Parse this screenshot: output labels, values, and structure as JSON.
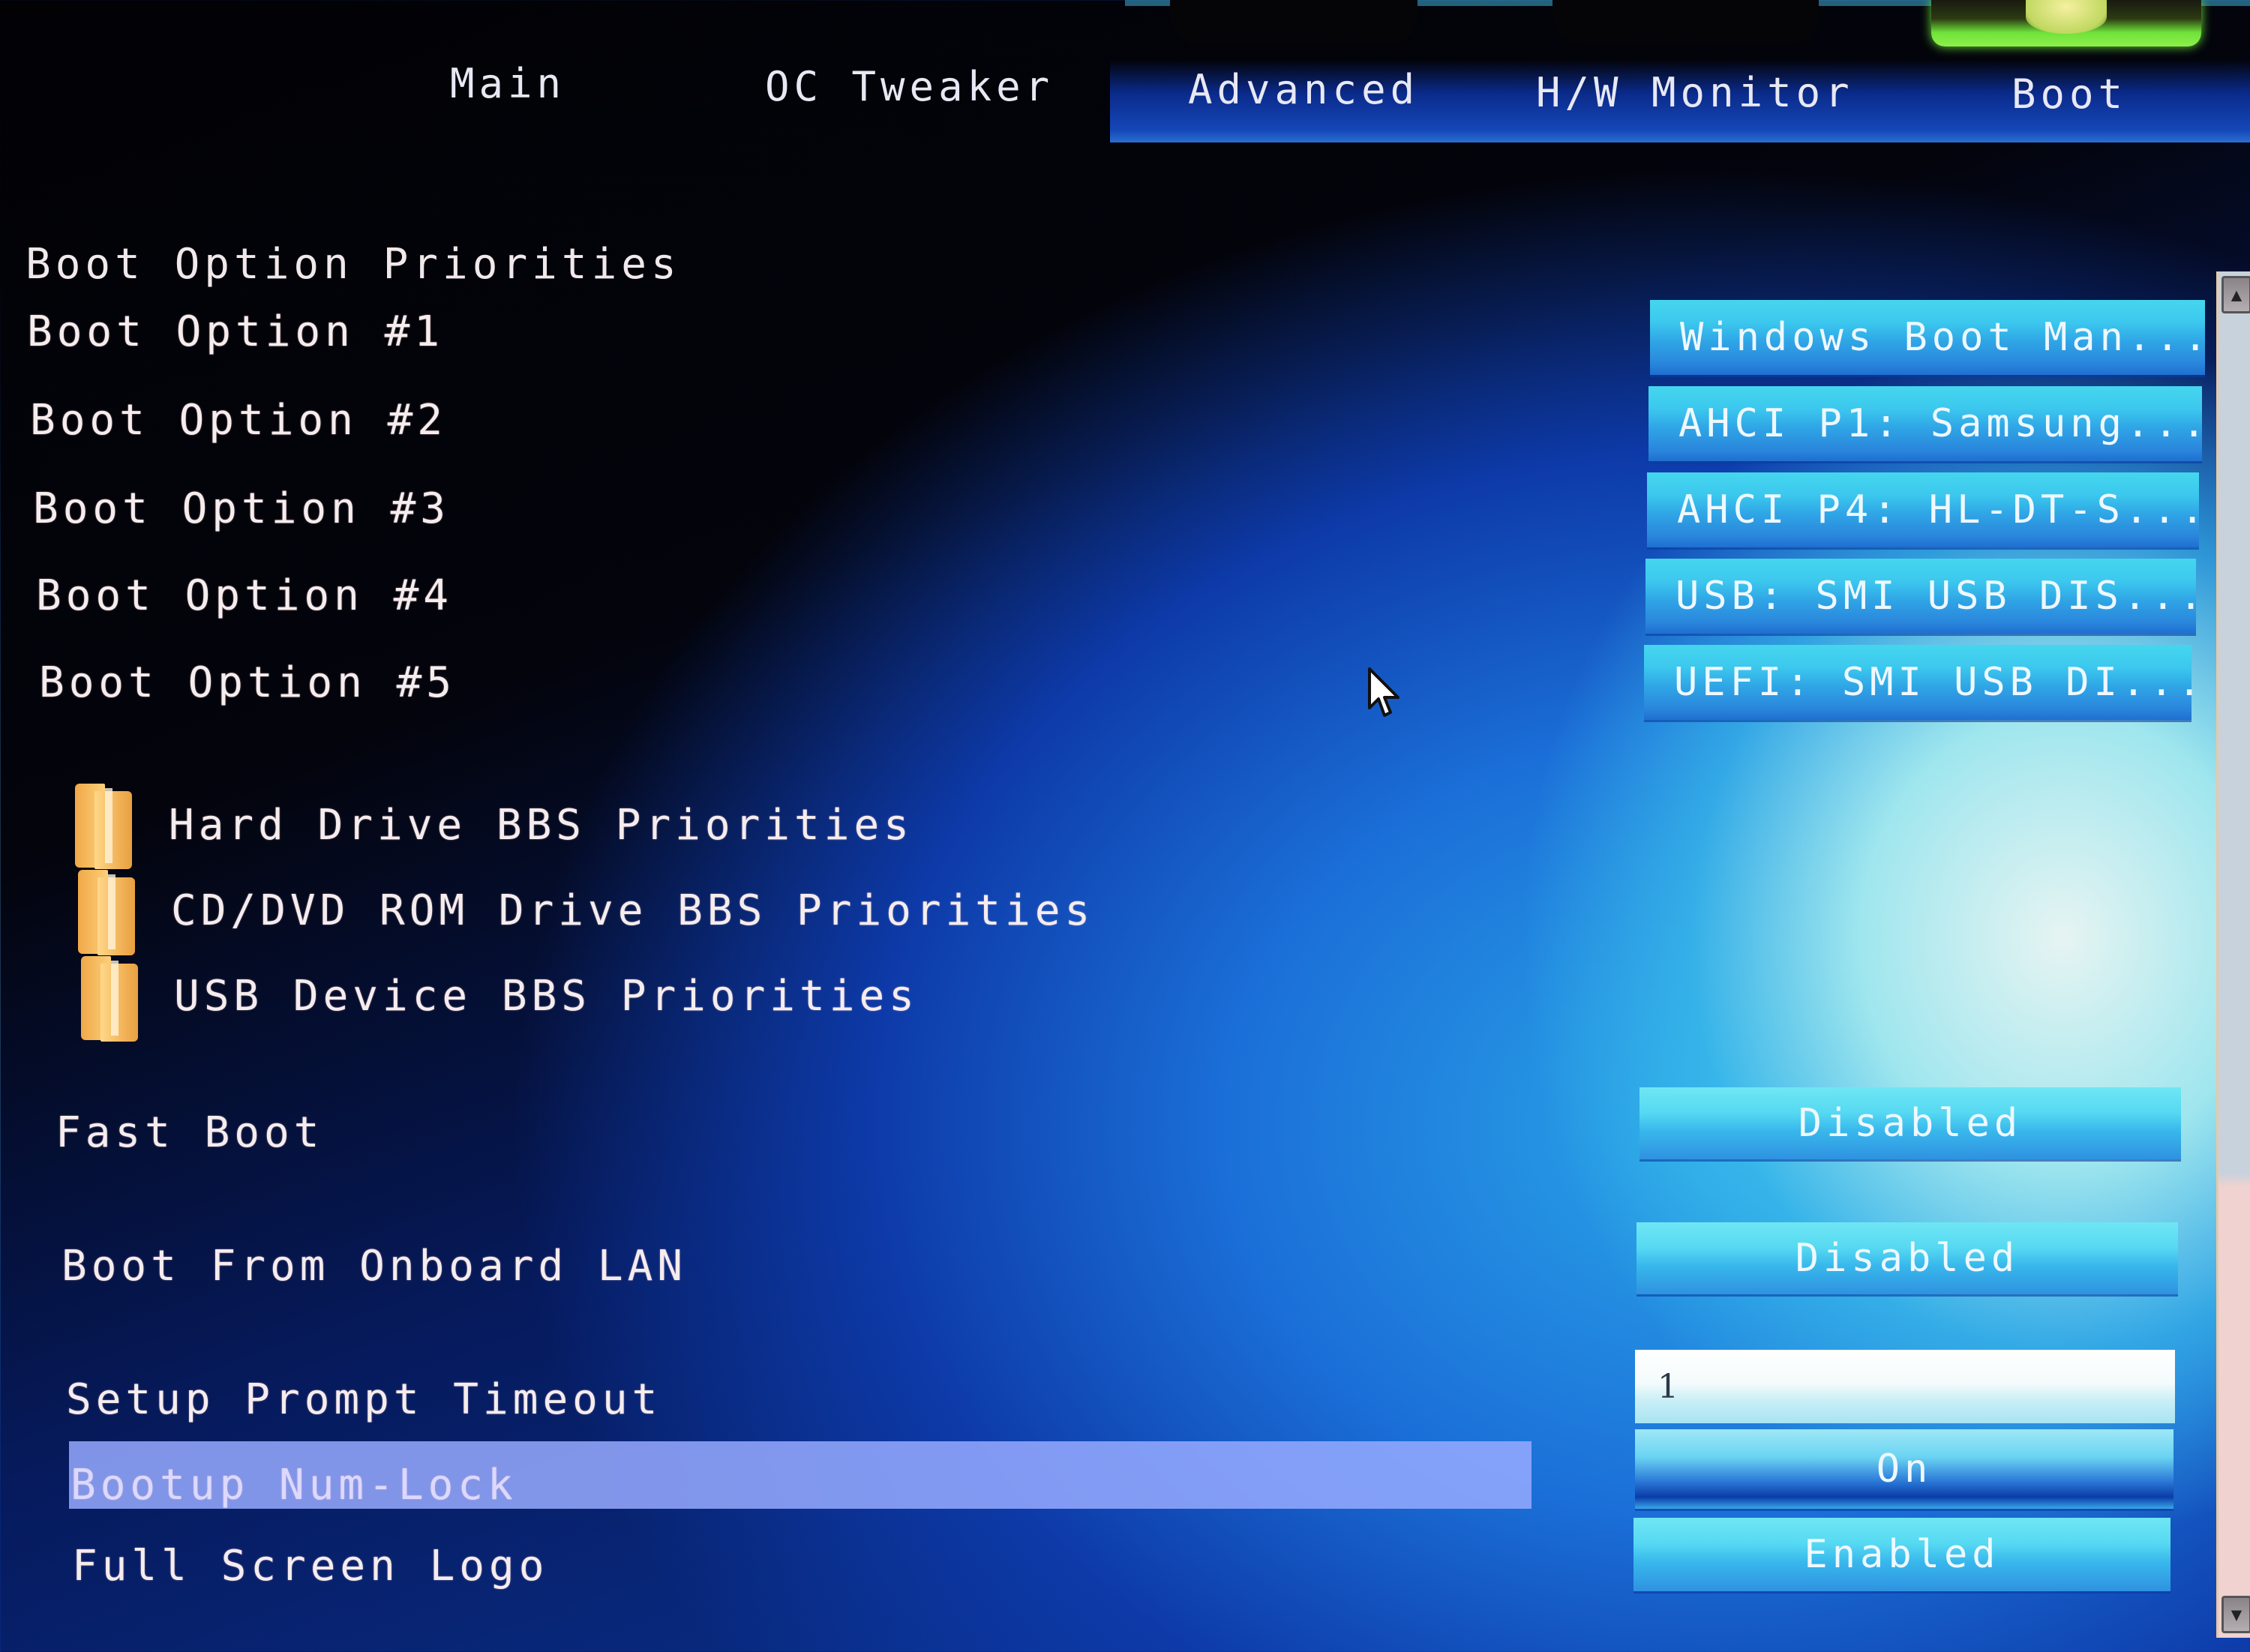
{
  "tabs": [
    {
      "label": "Main",
      "active": false
    },
    {
      "label": "OC Tweaker",
      "active": false
    },
    {
      "label": "Advanced",
      "active": false
    },
    {
      "label": "H/W Monitor",
      "active": false
    },
    {
      "label": "Boot",
      "active": true
    }
  ],
  "boot_priorities": {
    "title": "Boot Option Priorities",
    "options": [
      {
        "label": "Boot Option #1",
        "value": "Windows Boot Man..."
      },
      {
        "label": "Boot Option #2",
        "value": "AHCI P1: Samsung..."
      },
      {
        "label": "Boot Option #3",
        "value": "AHCI P4: HL-DT-S..."
      },
      {
        "label": "Boot Option #4",
        "value": "USB: SMI USB DIS..."
      },
      {
        "label": "Boot Option #5",
        "value": "UEFI: SMI USB DI..."
      }
    ]
  },
  "submenus": [
    {
      "label": "Hard Drive BBS Priorities",
      "icon": "folder-icon"
    },
    {
      "label": "CD/DVD ROM Drive BBS Priorities",
      "icon": "folder-icon"
    },
    {
      "label": "USB Device BBS Priorities",
      "icon": "folder-icon"
    }
  ],
  "settings": {
    "fast_boot": {
      "label": "Fast Boot",
      "value": "Disabled"
    },
    "boot_lan": {
      "label": "Boot From Onboard LAN",
      "value": "Disabled"
    },
    "setup_timeout": {
      "label": "Setup Prompt Timeout",
      "value": "1"
    },
    "numlock": {
      "label": "Bootup Num-Lock",
      "value": "On",
      "selected": true
    },
    "full_logo": {
      "label": "Full Screen Logo",
      "value": "Enabled"
    }
  },
  "scrollbar": {
    "up_icon": "▲",
    "down_icon": "▼"
  },
  "colors": {
    "accent": "#3cc8ee",
    "highlight": "#96aaff",
    "active_tab_icon": "#6fe23a"
  }
}
